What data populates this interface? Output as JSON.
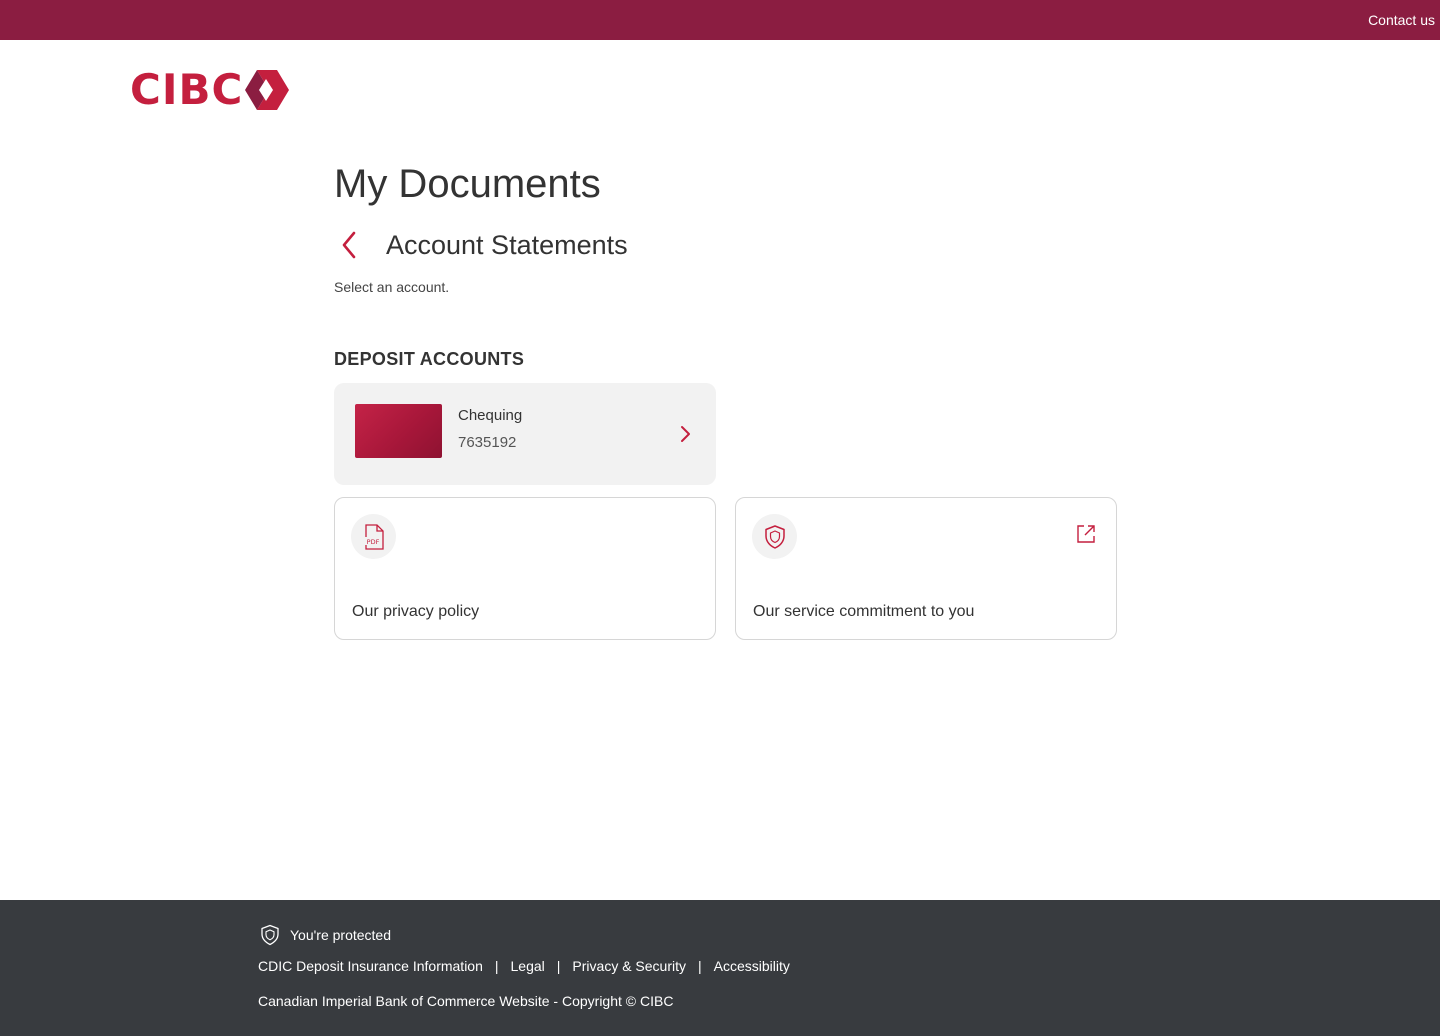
{
  "header": {
    "contact_label": "Contact us",
    "logo_text": "CIBC",
    "brand_color": "#c41f3e",
    "topbar_color": "#8b1d41"
  },
  "main": {
    "title": "My Documents",
    "subtitle": "Account Statements",
    "instructions": "Select an account.",
    "section_heading": "DEPOSIT ACCOUNTS",
    "account": {
      "name": "Chequing",
      "number": "7635192"
    },
    "tiles": [
      {
        "label": "Our privacy policy",
        "icon": "pdf-icon"
      },
      {
        "label": "Our service commitment to you",
        "icon": "shield-icon",
        "external": true
      }
    ]
  },
  "footer": {
    "protected_label": "You're protected",
    "links": [
      "CDIC Deposit Insurance Information",
      "Legal",
      "Privacy & Security",
      "Accessibility"
    ],
    "copyright": "Canadian Imperial Bank of Commerce Website - Copyright © CIBC",
    "background": "#383b3f"
  }
}
